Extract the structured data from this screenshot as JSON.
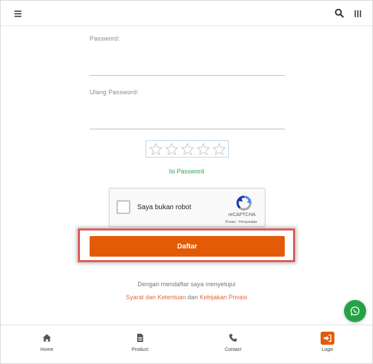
{
  "icons": {
    "menu": "hamburger-icon",
    "search": "search-icon",
    "grid": "vertical-bars-icon",
    "star": "star-outline-icon",
    "recaptcha": "recaptcha-logo-icon",
    "whatsapp": "whatsapp-icon"
  },
  "form": {
    "password_label": "Password:",
    "password_value": "",
    "confirm_label": "Ulang Password:",
    "confirm_value": "",
    "strength_stars_total": 5,
    "strength_stars_filled": 0,
    "strength_text": "Isi Password",
    "submit_label": "Daftar"
  },
  "recaptcha": {
    "label": "Saya bukan robot",
    "checked": false,
    "brand": "reCAPTCHA",
    "privacy": "Privasi",
    "separator": " - ",
    "terms": "Persyaratan"
  },
  "terms": {
    "line1": "Dengan mendaftar saya menyetujui",
    "link1": "Syarat dan Ketentuan",
    "conjunction": " dan ",
    "link2": "Kebijakan Privasi"
  },
  "bottom_nav": {
    "items": [
      {
        "label": "Home",
        "icon": "home-icon"
      },
      {
        "label": "Product",
        "icon": "document-icon"
      },
      {
        "label": "Contact",
        "icon": "phone-icon"
      },
      {
        "label": "Login",
        "icon": "sign-in-icon"
      }
    ]
  },
  "colors": {
    "accent": "#e35b06",
    "highlight_border": "#dd5a5a",
    "strength_text": "#3a9a5a",
    "link": "#e06a3a",
    "whatsapp": "#25a244"
  }
}
